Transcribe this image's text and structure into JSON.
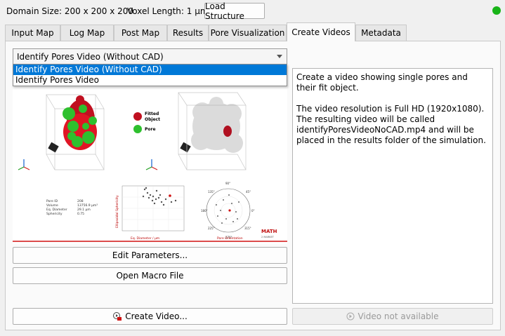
{
  "header": {
    "domain_size": "Domain Size: 200 x 200 x 200",
    "voxel_length": "Voxel Length: 1 µm",
    "load_button": "Load Structure",
    "status_color": "#18b418"
  },
  "tabs": [
    "Input Map",
    "Log Map",
    "Post Map",
    "Results",
    "Pore Visualization",
    "Create Videos",
    "Metadata"
  ],
  "active_tab": "Create Videos",
  "video_type": {
    "selected": "Identify Pores Video (Without CAD)",
    "options": [
      "Identify Pores Video (Without CAD)",
      "Identify Pores Video"
    ]
  },
  "preview": {
    "legend": {
      "fitted": "Fitted",
      "object": "Object",
      "pore": "Pore"
    },
    "stats_labels": [
      "Pore ID",
      "Volume",
      "Eq. Diameter",
      "Sphericity"
    ],
    "stats_values": [
      "208",
      "13756.9 µm³",
      "29.1 µm",
      "0.75"
    ],
    "scatter_xlabel": "Eq. Diameter / µm",
    "scatter_ylabel": "Ellipsoidal Sphericity",
    "polar_label": "Pore Orientation",
    "polar_angles": [
      "90°",
      "180°",
      "270°",
      "0°",
      "135°",
      "45°",
      "225°",
      "315°"
    ],
    "logo_line1": "MATH",
    "logo_line2": "2 MARKET"
  },
  "description": {
    "line1": "Create a video showing single pores and their fit object.",
    "line2": "The video resolution is Full HD (1920x1080).",
    "line3": "The resulting video will be called identifyPoresVideoNoCAD.mp4 and will be placed in the results folder of the simulation."
  },
  "buttons": {
    "edit_parameters": "Edit Parameters...",
    "open_macro": "Open Macro File",
    "create_video": "Create Video...",
    "video_not_available": "Video not available"
  }
}
